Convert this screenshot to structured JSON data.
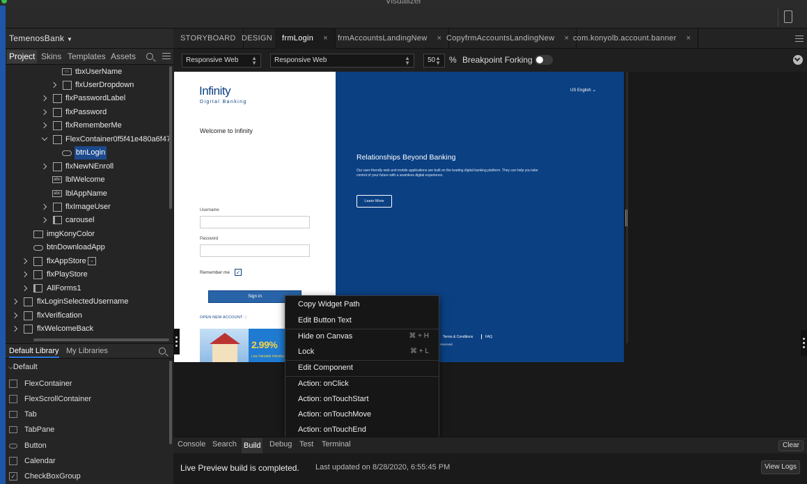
{
  "window": {
    "title": "Visualizer"
  },
  "project": {
    "name": "TemenosBank",
    "tabs": [
      "Project",
      "Skins",
      "Templates",
      "Assets"
    ]
  },
  "tree": [
    {
      "label": "tbxUserName",
      "icon": "textbox-icon"
    },
    {
      "label": "flxUserDropdown",
      "icon": "flex-icon"
    },
    {
      "label": "flxPasswordLabel",
      "icon": "flex-icon"
    },
    {
      "label": "flxPassword",
      "icon": "flex-icon"
    },
    {
      "label": "flxRememberMe",
      "icon": "flex-icon"
    },
    {
      "label": "FlexContainer0f5f41e480a6f47",
      "icon": "flex-icon"
    },
    {
      "label": "btnLogin",
      "icon": "button-icon"
    },
    {
      "label": "flxNewNEnroll",
      "icon": "flex-icon"
    },
    {
      "label": "lblWelcome",
      "icon": "label-icon"
    },
    {
      "label": "lblAppName",
      "icon": "label-icon"
    },
    {
      "label": "flxImageUser",
      "icon": "flex-icon"
    },
    {
      "label": "carousel",
      "icon": "segment-icon"
    },
    {
      "label": "imgKonyColor",
      "icon": "image-icon"
    },
    {
      "label": "btnDownloadApp",
      "icon": "button-icon"
    },
    {
      "label": "flxAppStore",
      "icon": "flex-icon"
    },
    {
      "label": "flxPlayStore",
      "icon": "flex-icon"
    },
    {
      "label": "AllForms1",
      "icon": "segment-icon"
    },
    {
      "label": "flxLoginSelectedUsername",
      "icon": "flex-icon"
    },
    {
      "label": "flxVerification",
      "icon": "flex-icon"
    },
    {
      "label": "flxWelcomeBack",
      "icon": "flex-icon"
    }
  ],
  "library": {
    "tabs": [
      "Default Library",
      "My Libraries"
    ],
    "group": "Default",
    "items": [
      "FlexContainer",
      "FlexScrollContainer",
      "Tab",
      "TabPane",
      "Button",
      "Calendar",
      "CheckBoxGroup"
    ]
  },
  "main_tabs": {
    "storyboard": "STORYBOARD",
    "design": "DESIGN",
    "files": [
      "frmLogin",
      "frmAccountsLandingNew",
      "CopyfrmAccountsLandingNew",
      "com.konyolb.account.banner"
    ],
    "close": "×"
  },
  "toolbar": {
    "channel": "Responsive Web",
    "platform": "Responsive Web",
    "zoom": "50",
    "zoom_unit": "%",
    "breakpoint_label": "Breakpoint Forking",
    "breakpoint_on": false
  },
  "preview": {
    "logo": "Infinity",
    "logo_sub": "Digital Banking",
    "welcome": "Welcome to Infinity",
    "username_label": "Username",
    "password_label": "Password",
    "remember": "Remember me",
    "signin": "Sign in",
    "open_account": "OPEN NEW ACCOUNT",
    "promo_rate": "2.99%",
    "promo_sub": "Low Variable Introduc",
    "language": "US English",
    "hero_title": "Relationships Beyond Banking",
    "hero_text": "Our user-friendly web and mobile applications are built on the leading digital banking platform. They can help you take control of your future with a seamless digital experience.",
    "learn_more": "Learn More",
    "terms": "Terms & Conditions",
    "faq": "FAQ",
    "reserved": "reserved."
  },
  "context_menu": [
    {
      "label": "Copy Widget Path",
      "shortcut": ""
    },
    {
      "label": "Edit Button Text",
      "shortcut": ""
    },
    {
      "label": "Hide on Canvas",
      "shortcut": "⌘ + H"
    },
    {
      "label": "Lock",
      "shortcut": "⌘ + L"
    },
    {
      "label": "Edit Component",
      "shortcut": ""
    },
    {
      "label": "Action: onClick",
      "shortcut": ""
    },
    {
      "label": "Action: onTouchStart",
      "shortcut": ""
    },
    {
      "label": "Action: onTouchMove",
      "shortcut": ""
    },
    {
      "label": "Action: onTouchEnd",
      "shortcut": ""
    }
  ],
  "bottom": {
    "tabs": [
      "Console",
      "Search",
      "Build",
      "Debug",
      "Test",
      "Terminal"
    ],
    "active_tab": "Build",
    "clear": "Clear",
    "message": "Live Preview build is completed.",
    "updated": "Last updated on 8/28/2020, 6:55:45 PM",
    "view_logs": "View Logs"
  },
  "colors": {
    "accent": "#1f56a8",
    "selection": "#1c4a8c",
    "brand_blue": "#0b4083"
  }
}
